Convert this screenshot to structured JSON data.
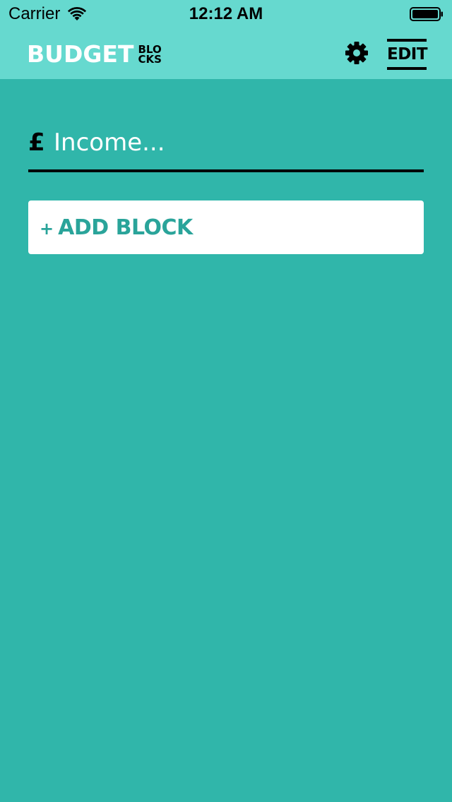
{
  "status_bar": {
    "carrier": "Carrier",
    "time": "12:12 AM",
    "wifi_icon": "wifi-icon",
    "battery_icon": "battery-icon"
  },
  "navbar": {
    "logo_main": "BUDGET",
    "logo_sub_line1": "BLO",
    "logo_sub_line2": "CKS",
    "settings_icon": "gear-icon",
    "edit_label": "EDIT"
  },
  "income": {
    "currency_symbol": "£",
    "placeholder": "Income...",
    "value": ""
  },
  "add_block": {
    "icon": "+",
    "label": "ADD BLOCK"
  },
  "colors": {
    "background": "#30b6aa",
    "header": "#66d9cf",
    "accent_text": "#2aa49a"
  }
}
